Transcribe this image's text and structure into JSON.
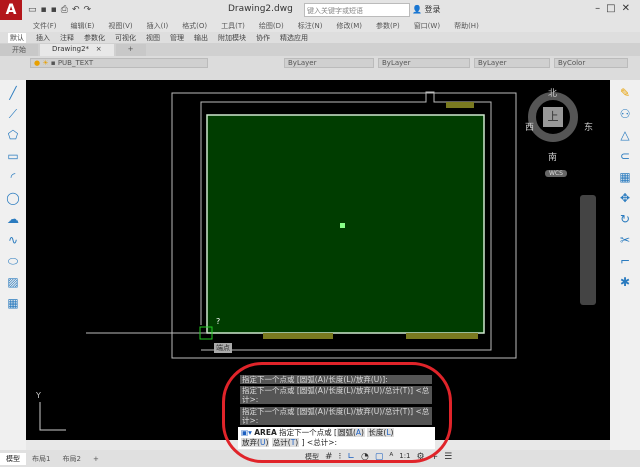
{
  "app": {
    "title": "Drawing2.dwg",
    "search_placeholder": "键入关键字或短语",
    "login": "登录",
    "logo": "A"
  },
  "menu": [
    "文件(F)",
    "编辑(E)",
    "视图(V)",
    "插入(I)",
    "格式(O)",
    "工具(T)",
    "绘图(D)",
    "标注(N)",
    "修改(M)",
    "参数(P)",
    "窗口(W)",
    "帮助(H)"
  ],
  "ribbon_tabs": [
    "默认",
    "插入",
    "注释",
    "参数化",
    "可视化",
    "视图",
    "管理",
    "输出",
    "附加模块",
    "协作",
    "精选应用"
  ],
  "file_tabs": {
    "start": "开始",
    "active": "Drawing2*",
    "close": "×",
    "add": "+"
  },
  "layer": {
    "name": "PUB_TEXT",
    "color": "ByLayer",
    "linetype": "ByLayer",
    "lineweight": "ByLayer",
    "plotstyle": "ByColor"
  },
  "viewcube": {
    "north": "北",
    "south": "南",
    "east": "东",
    "west": "西",
    "top": "上",
    "wcs": "WCS"
  },
  "canvas": {
    "cursor_hint": "?",
    "snap_tooltip": "端点",
    "fill_color": "#003d00",
    "axis_y": "Y"
  },
  "command": {
    "history": [
      "指定下一个点或 [圆弧(A)/长度(L)/放弃(U)]:",
      "指定下一个点或 [圆弧(A)/长度(L)/放弃(U)/总计(T)] <总计>:",
      "指定下一个点或 [圆弧(A)/长度(L)/放弃(U)/总计(T)] <总计>:"
    ],
    "cmd": "AREA",
    "prompt": "指定下一个点或 [",
    "opt_arc": "圆弧(",
    "opt_arc_k": "A",
    "opt_len": "长度(",
    "opt_len_k": "L",
    "opt_undo": "放弃(",
    "opt_undo_k": "U",
    "opt_total": "总计(",
    "opt_total_k": "T",
    "close_paren": ")",
    "tail": "] <总计>:"
  },
  "layout_tabs": [
    "模型",
    "布局1",
    "布局2",
    "+"
  ],
  "status": {
    "model": "模型",
    "scale": "1:1"
  },
  "highlight_color": "#e0242a"
}
